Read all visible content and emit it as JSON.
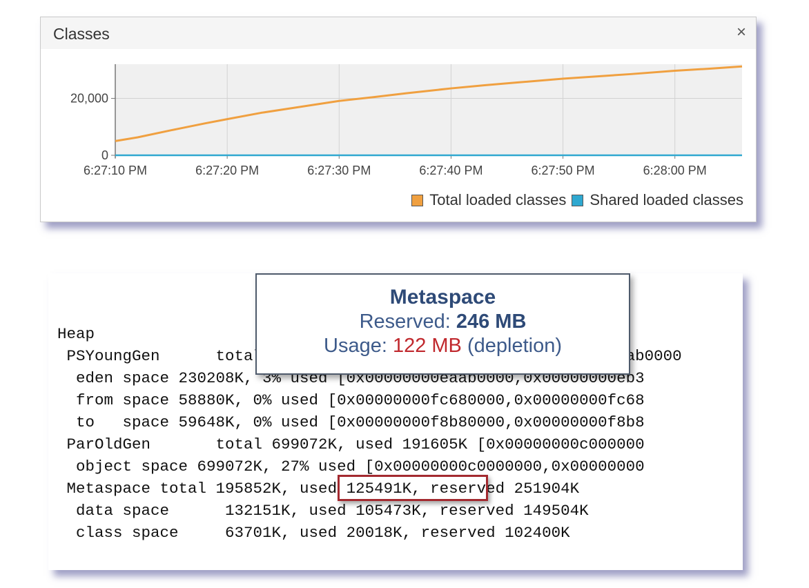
{
  "classes_panel": {
    "title": "Classes",
    "close_label": "×",
    "legend": [
      {
        "label": "Total loaded classes",
        "color": "#f0a040"
      },
      {
        "label": "Shared loaded classes",
        "color": "#2fa8d0"
      }
    ]
  },
  "chart_data": {
    "type": "line",
    "title": "",
    "x_tick_labels": [
      "6:27:10 PM",
      "6:27:20 PM",
      "6:27:30 PM",
      "6:27:40 PM",
      "6:27:50 PM",
      "6:28:00 PM"
    ],
    "y_tick_labels": [
      "0",
      "20,000"
    ],
    "ylim": [
      0,
      32000
    ],
    "xlim_seconds_after_6_27_00": [
      10,
      66
    ],
    "grid": true,
    "legend_position": "bottom-right",
    "series": [
      {
        "name": "Total loaded classes",
        "color": "#f0a040",
        "x": [
          10,
          12,
          15,
          18,
          20,
          23,
          26,
          30,
          33,
          36,
          40,
          43,
          46,
          50,
          53,
          56,
          60,
          63,
          66
        ],
        "y": [
          5000,
          6300,
          8800,
          11200,
          12700,
          14900,
          16700,
          19100,
          20400,
          21800,
          23500,
          24600,
          25600,
          26900,
          27700,
          28500,
          29700,
          30400,
          31200
        ]
      },
      {
        "name": "Shared loaded classes",
        "color": "#2fa8d0",
        "x": [
          10,
          66
        ],
        "y": [
          0,
          0
        ]
      }
    ]
  },
  "heap": {
    "lines": [
      "Heap",
      " PSYoungGen      total 348672K, used 0000000000000000000000eaab0000",
      "  eden space 230208K, 3% used [0x00000000eaab0000,0x00000000eb3",
      "  from space 58880K, 0% used [0x00000000fc680000,0x00000000fc68",
      "  to   space 59648K, 0% used [0x00000000f8b80000,0x00000000f8b8",
      " ParOldGen       total 699072K, used 191605K [0x00000000c000000",
      "  object space 699072K, 27% used [0x00000000c0000000,0x00000000",
      " Metaspace total 195852K, used 125491K, reserved 251904K",
      "  data space      132151K, used 105473K, reserved 149504K",
      "  class space     63701K, used 20018K, reserved 102400K"
    ]
  },
  "tooltip": {
    "title": "Metaspace",
    "reserved_label": "Reserved: ",
    "reserved_value": "246 MB",
    "usage_label": "Usage: ",
    "usage_value": "122 MB",
    "usage_note": " (depletion)"
  }
}
